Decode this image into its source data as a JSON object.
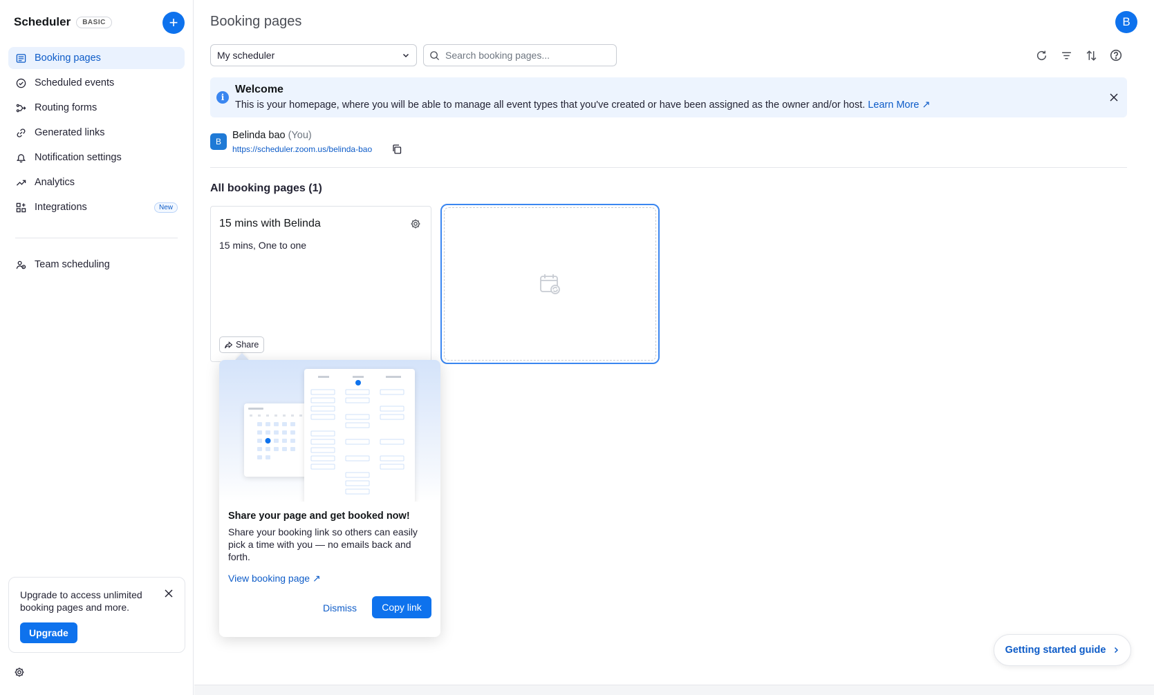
{
  "sidebar": {
    "brand": "Scheduler",
    "plan_badge": "BASIC",
    "items": [
      {
        "label": "Booking pages",
        "icon": "booking-pages-icon",
        "active": true
      },
      {
        "label": "Scheduled events",
        "icon": "check-circle-icon"
      },
      {
        "label": "Routing forms",
        "icon": "routing-icon"
      },
      {
        "label": "Generated links",
        "icon": "link-icon"
      },
      {
        "label": "Notification settings",
        "icon": "bell-icon"
      },
      {
        "label": "Analytics",
        "icon": "analytics-icon"
      },
      {
        "label": "Integrations",
        "icon": "integrations-icon",
        "badge": "New"
      }
    ],
    "team_item": {
      "label": "Team scheduling",
      "icon": "team-icon"
    },
    "upgrade": {
      "text": "Upgrade to access unlimited booking pages and more.",
      "button": "Upgrade"
    }
  },
  "header": {
    "title": "Booking pages",
    "avatar_initial": "B"
  },
  "toolbar": {
    "scheduler_select": "My scheduler",
    "search_placeholder": "Search booking pages..."
  },
  "welcome": {
    "title": "Welcome",
    "body": "This is your homepage, where you will be able to manage all event types that you've created or have been assigned as the owner and/or host.",
    "link": "Learn More"
  },
  "owner": {
    "initial": "B",
    "name": "Belinda bao",
    "you": "(You)",
    "url": "https://scheduler.zoom.us/belinda-bao"
  },
  "section_title": "All booking pages (1)",
  "card": {
    "title": "15 mins with Belinda",
    "subtitle": "15 mins, One to one",
    "share": "Share"
  },
  "popover": {
    "title": "Share your page and get booked now!",
    "body": "Share your booking link so others can easily pick a time with you — no emails back and forth.",
    "link": "View booking page",
    "dismiss": "Dismiss",
    "copy": "Copy link"
  },
  "getting_started": "Getting started guide",
  "colors": {
    "accent": "#0e72ed",
    "active_bg": "#eaf2fe",
    "welcome_bg": "#edf4fe"
  }
}
